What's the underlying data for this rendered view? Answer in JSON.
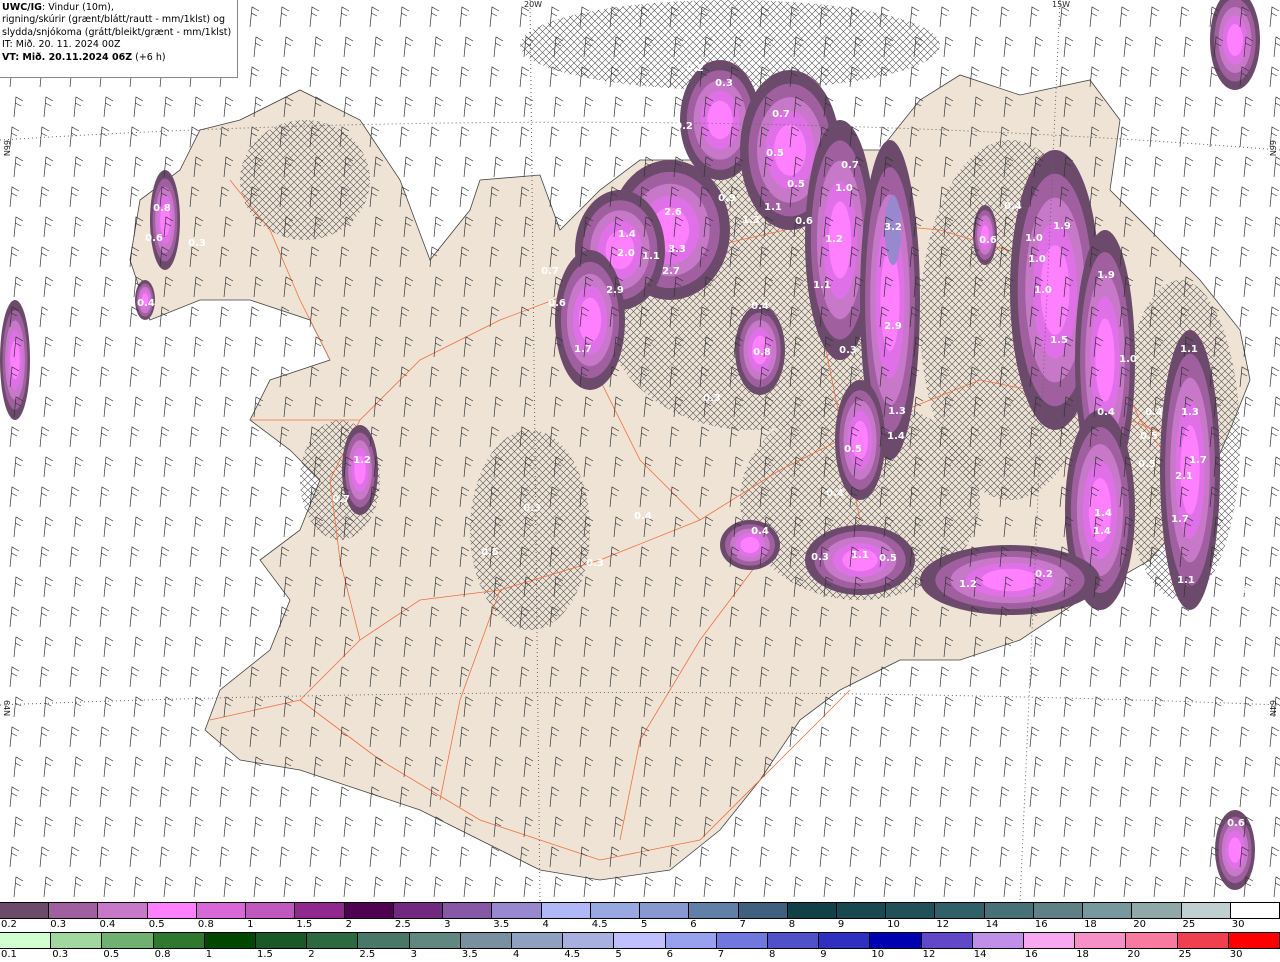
{
  "title": {
    "model": "UWC/IG",
    "line1_rest": ": Vindur (10m),",
    "line2": "rigning/skúrir (grænt/blátt/rautt - mm/1klst) og",
    "line3": "slydda/snjókoma (grátt/bleikt/grænt - mm/1klst)",
    "issue_time": "IT: Mið. 20. 11. 2024 00Z",
    "valid_time": "VT: Mið. 20.11.2024 06Z",
    "lead": " (+6 h)"
  },
  "map": {
    "grid_labels": {
      "lon": [
        "20W",
        "15W"
      ],
      "lat": [
        "66N",
        "64N"
      ]
    },
    "colors": {
      "land": "#efe3d6",
      "sea": "#ffffff",
      "roads": "#f07040",
      "coast": "#555555",
      "wind_barb": "#333333"
    },
    "precip_labels": [
      "0.2",
      "0.3",
      "0.2",
      "0.7",
      "0.5",
      "0.5",
      "0.7",
      "1.0",
      "0.9",
      "1.3",
      "1.1",
      "0.6",
      "2.6",
      "1.4",
      "2.0",
      "1.1",
      "3.3",
      "2.7",
      "2.9",
      "1.2",
      "3.2",
      "1.1",
      "0.4",
      "0.8",
      "2.9",
      "0.3",
      "0.7",
      "0.6",
      "1.7",
      "0.8",
      "0.6",
      "0.3",
      "0.4",
      "0.4",
      "0.5",
      "0.3",
      "1.3",
      "1.4",
      "0.5",
      "0.4",
      "1.2",
      "0.7",
      "0.3",
      "0.4",
      "0.5",
      "0.3",
      "0.3",
      "1.1",
      "0.5",
      "1.2",
      "0.2",
      "0.4",
      "1.9",
      "1.0",
      "1.0",
      "0.6",
      "1.9",
      "1.0",
      "1.5",
      "1.0",
      "0.4",
      "0.4",
      "1.3",
      "0.5",
      "1.1",
      "1.7",
      "0.5",
      "2.1",
      "1.4",
      "1.4",
      "1.7",
      "1.1",
      "0.6",
      "0.6",
      "0.4"
    ]
  },
  "legend": {
    "snow": {
      "labels": [
        "0.2",
        "0.3",
        "0.4",
        "0.5",
        "0.8",
        "1",
        "1.5",
        "2",
        "2.5",
        "3",
        "3.5",
        "4",
        "4.5",
        "5",
        "6",
        "7",
        "8",
        "9",
        "10",
        "12",
        "14",
        "16",
        "18",
        "20",
        "25",
        "30"
      ],
      "colors": [
        "#6b4a6b",
        "#a060a0",
        "#c878c8",
        "#ff80ff",
        "#d868d8",
        "#c058c0",
        "#902890",
        "#500050",
        "#702880",
        "#8858a8",
        "#9888d0",
        "#b0b8f8",
        "#98a8e0",
        "#8898d0",
        "#6080a8",
        "#406080",
        "#104048",
        "#184850",
        "#205058",
        "#306068",
        "#487078",
        "#608088",
        "#7898a0",
        "#90a8a8",
        "#c0d0d0",
        "#ffffff"
      ]
    },
    "rain": {
      "labels": [
        "0.1",
        "0.3",
        "0.5",
        "0.8",
        "1",
        "1.5",
        "2",
        "2.5",
        "3",
        "3.5",
        "4",
        "4.5",
        "5",
        "6",
        "7",
        "8",
        "9",
        "10",
        "12",
        "14",
        "16",
        "18",
        "20",
        "25",
        "30"
      ],
      "colors": [
        "#d0ffd0",
        "#a0d8a0",
        "#70b070",
        "#307830",
        "#004800",
        "#1a5828",
        "#2c6840",
        "#4a7868",
        "#608880",
        "#7890a0",
        "#90a0c0",
        "#a8b0e0",
        "#c0c0ff",
        "#98a0f0",
        "#7078e0",
        "#5050c8",
        "#3030c0",
        "#0000b0",
        "#6048c8",
        "#c090e8",
        "#f8a8f0",
        "#f890c8",
        "#f87aa0",
        "#f04050",
        "#ff0000"
      ]
    }
  }
}
